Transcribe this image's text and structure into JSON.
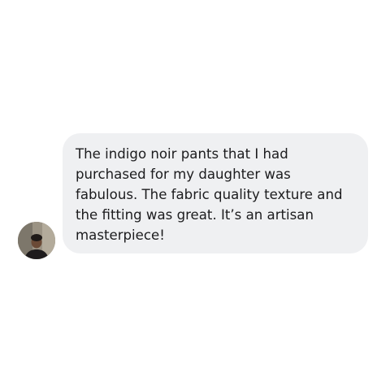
{
  "message": {
    "text": "The indigo noir pants that I had purchased for my daughter was fabulous. The fabric quality texture and the fitting was great. It’s an artisan masterpiece!",
    "bubble_color": "#eff0f2",
    "text_color": "#1c1c1e"
  },
  "avatar": {
    "icon": "user-photo-avatar"
  }
}
